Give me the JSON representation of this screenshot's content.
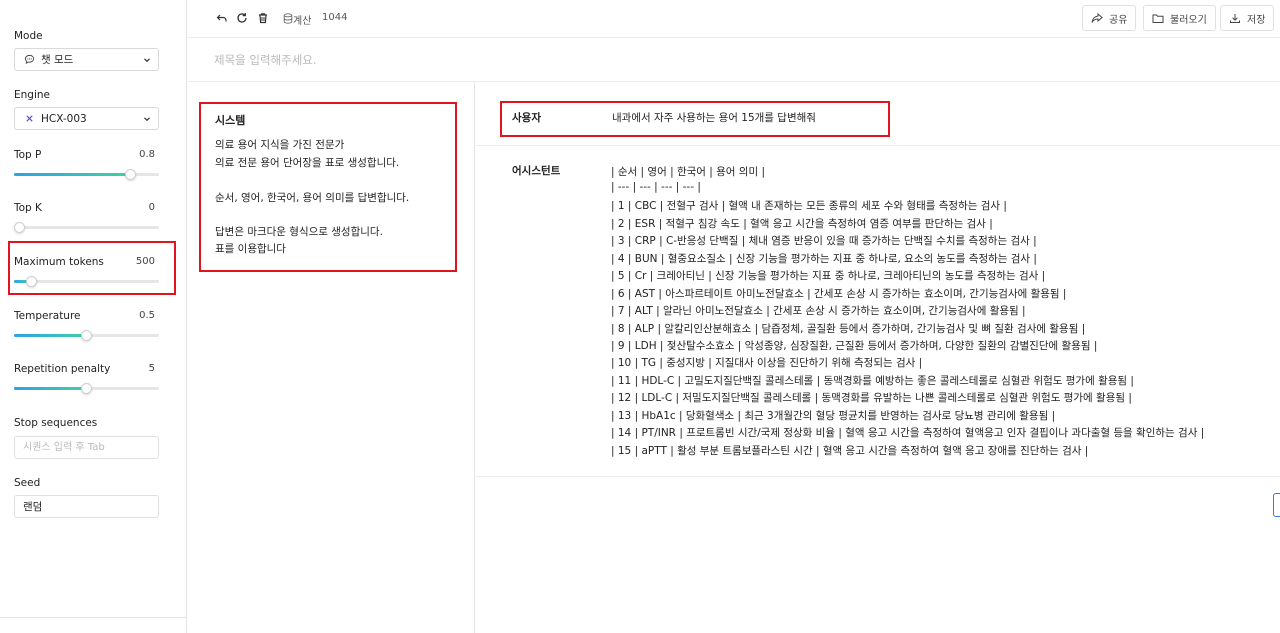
{
  "sidebar": {
    "mode": {
      "label": "Mode",
      "value": "챗 모드",
      "icon": "chat-bubble-icon"
    },
    "engine": {
      "label": "Engine",
      "value": "HCX-003",
      "icon": "x-mark-icon"
    },
    "top_p": {
      "label": "Top P",
      "value": "0.8",
      "level": 0.8
    },
    "top_k": {
      "label": "Top K",
      "value": "0",
      "level": 0
    },
    "max_tokens": {
      "label": "Maximum tokens",
      "value": "500",
      "level": 0.12
    },
    "temperature": {
      "label": "Temperature",
      "value": "0.5",
      "level": 0.5
    },
    "repetition_penalty": {
      "label": "Repetition penalty",
      "value": "5",
      "level": 0.5
    },
    "stop_sequences": {
      "label": "Stop sequences",
      "placeholder": "시퀀스 입력 후 Tab"
    },
    "seed": {
      "label": "Seed",
      "value": "랜덤"
    }
  },
  "toolbar": {
    "calc_label": "계산",
    "calc_value": "1044",
    "share_label": "공유",
    "load_label": "불러오기",
    "save_label": "저장"
  },
  "title": {
    "placeholder": "제목을 입력해주세요."
  },
  "system": {
    "heading": "시스템",
    "lines": [
      "의료 용어 지식을 가진 전문가",
      "의료 전문 용어 단어장을 표로 생성합니다.",
      "순서, 영어, 한국어, 용어 의미를 답변합니다.",
      "답변은 마크다운 형식으로 생성합니다.",
      "표를 이용합니다"
    ]
  },
  "user": {
    "role": "사용자",
    "message": "내과에서 자주 사용하는 용어 15개를 답변해줘"
  },
  "assistant": {
    "role": "어시스턴트",
    "lines": [
      "| 순서 | 영어 | 한국어 | 용어 의미 |",
      "| --- | --- | --- | --- |",
      "| 1 | CBC | 전혈구 검사 | 혈액 내 존재하는 모든 종류의 세포 수와 형태를 측정하는 검사 |",
      "| 2 | ESR | 적혈구 침강 속도 | 혈액 응고 시간을 측정하여 염증 여부를 판단하는 검사 |",
      "| 3 | CRP | C-반응성 단백질 | 체내 염증 반응이 있을 때 증가하는 단백질 수치를 측정하는 검사 |",
      "| 4 | BUN | 혈중요소질소 | 신장 기능을 평가하는 지표 중 하나로, 요소의 농도를 측정하는 검사 |",
      "| 5 | Cr | 크레아티닌 | 신장 기능을 평가하는 지표 중 하나로, 크레아티닌의 농도를 측정하는 검사 |",
      "| 6 | AST | 아스파르테이트 아미노전달효소 | 간세포 손상 시 증가하는 효소이며, 간기능검사에 활용됨 |",
      "| 7 | ALT | 알라닌 아미노전달효소 | 간세포 손상 시 증가하는 효소이며, 간기능검사에 활용됨 |",
      "| 8 | ALP | 알칼리인산분해효소 | 담즙정체, 골질환 등에서 증가하며, 간기능검사 및 뼈 질환 검사에 활용됨 |",
      "| 9 | LDH | 젖산탈수소효소 | 악성종양, 심장질환, 근질환 등에서 증가하며, 다양한 질환의 감별진단에 활용됨 |",
      "| 10 | TG | 중성지방 | 지질대사 이상을 진단하기 위해 측정되는 검사 |",
      "| 11 | HDL-C | 고밀도지질단백질 콜레스테롤 | 동맥경화를 예방하는 좋은 콜레스테롤로 심혈관 위험도 평가에 활용됨 |",
      "| 12 | LDL-C | 저밀도지질단백질 콜레스테롤 | 동맥경화를 유발하는 나쁜 콜레스테롤로 심혈관 위험도 평가에 활용됨 |",
      "| 13 | HbA1c | 당화혈색소 | 최근 3개월간의 혈당 평균치를 반영하는 검사로 당뇨병 관리에 활용됨 |",
      "| 14 | PT/INR | 프로트롬빈 시간/국제 정상화 비율 | 혈액 응고 시간을 측정하여 혈액응고 인자 결핍이나 과다출혈 등을 확인하는 검사 |",
      "| 15 | aPTT | 활성 부분 트롬보플라스틴 시간 | 혈액 응고 시간을 측정하여 혈액 응고 장애를 진단하는 검사 |"
    ]
  },
  "colors": {
    "highlight": "#e0141e",
    "slider_start": "#2da2e6",
    "slider_end": "#3fd1a5"
  }
}
